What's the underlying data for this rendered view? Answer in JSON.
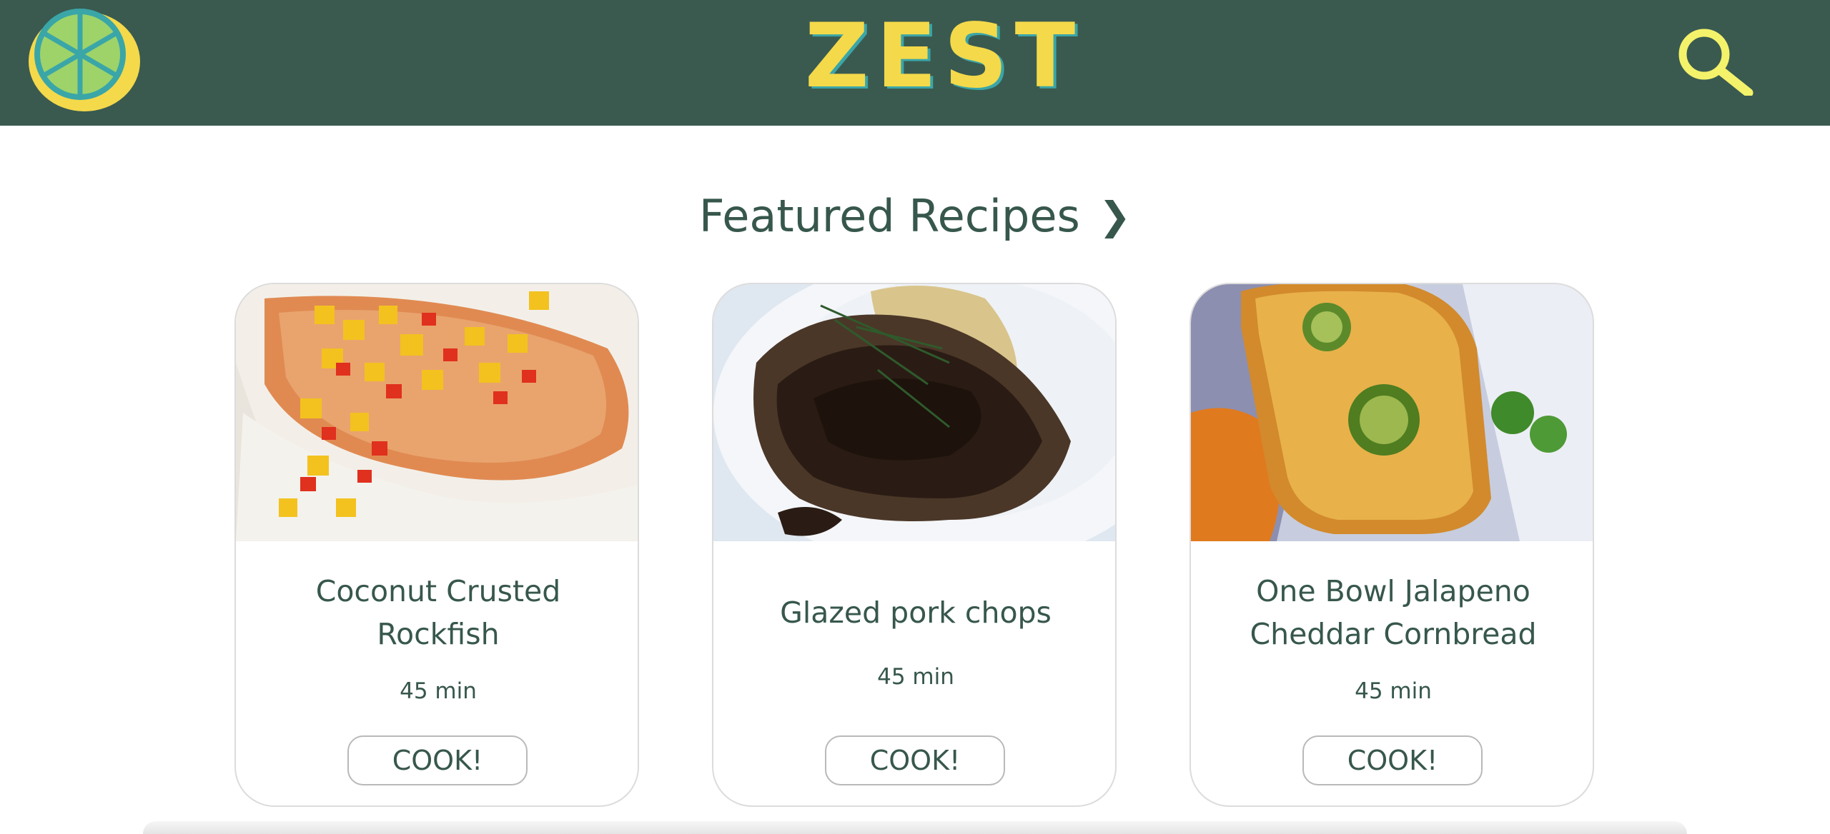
{
  "brand": {
    "name": "ZEST",
    "logo_icon": "lemon-slice-icon",
    "colors": {
      "header_bg": "#3a5a50",
      "accent_yellow": "#f4d94a",
      "accent_teal": "#3aa6a8"
    }
  },
  "header": {
    "search_icon": "search-icon"
  },
  "featured": {
    "title": "Featured Recipes",
    "chevron": "❯",
    "recipes": [
      {
        "title": "Coconut Crusted Rockfish",
        "time": "45 min",
        "button": "COOK!",
        "image": "coconut-crusted-rockfish-photo"
      },
      {
        "title": "Glazed pork chops",
        "time": "45 min",
        "button": "COOK!",
        "image": "glazed-pork-chops-photo"
      },
      {
        "title": "One Bowl Jalapeno Cheddar Cornbread",
        "time": "45 min",
        "button": "COOK!",
        "image": "jalapeno-cornbread-photo"
      }
    ]
  }
}
